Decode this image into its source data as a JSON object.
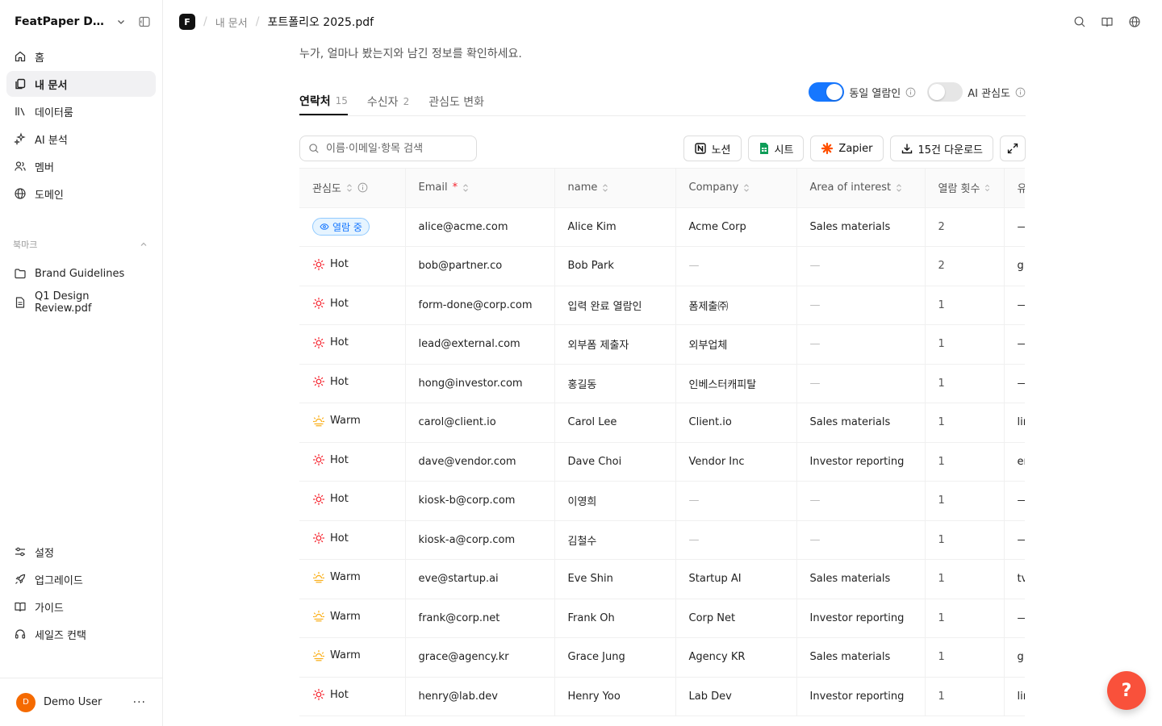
{
  "sidebar": {
    "workspace": "FeatPaper Desi...",
    "nav": [
      {
        "label": "홈",
        "icon": "home-icon"
      },
      {
        "label": "내 문서",
        "icon": "documents-icon",
        "active": true
      },
      {
        "label": "데이터룸",
        "icon": "library-icon"
      },
      {
        "label": "AI 분석",
        "icon": "sparkles-icon"
      },
      {
        "label": "멤버",
        "icon": "users-icon"
      },
      {
        "label": "도메인",
        "icon": "globe-icon"
      }
    ],
    "bookmark_title": "북마크",
    "bookmarks": [
      {
        "label": "Brand Guidelines",
        "icon": "folder-icon"
      },
      {
        "label": "Q1 Design Review.pdf",
        "icon": "file-icon"
      }
    ],
    "bottom": [
      {
        "label": "설정",
        "icon": "settings-icon"
      },
      {
        "label": "업그레이드",
        "icon": "rocket-icon"
      },
      {
        "label": "가이드",
        "icon": "book-icon"
      },
      {
        "label": "세일즈 컨택",
        "icon": "headset-icon"
      }
    ],
    "user": {
      "initial": "D",
      "name": "Demo User",
      "more": "···"
    }
  },
  "topbar": {
    "logo": "F",
    "crumbs": [
      "내 문서",
      "포트폴리오 2025.pdf"
    ]
  },
  "subtitle": "누가, 얼마나 봤는지와 남긴 정보를 확인하세요.",
  "tabs": [
    {
      "label": "연락처",
      "count": "15"
    },
    {
      "label": "수신자",
      "count": "2"
    },
    {
      "label": "관심도 변화",
      "count": ""
    }
  ],
  "toggles": {
    "same_viewer": {
      "label": "동일 열람인",
      "on": true
    },
    "ai_interest": {
      "label": "AI 관심도",
      "on": false
    }
  },
  "search": {
    "placeholder": "이름·이메일·항목 검색"
  },
  "buttons": {
    "notion": "노션",
    "sheet": "시트",
    "zapier": "Zapier",
    "download": "15건 다운로드"
  },
  "columns": [
    "관심도",
    "Email",
    "name",
    "Company",
    "Area of interest",
    "열람 횟수",
    "유"
  ],
  "required_mark": "*",
  "rows": [
    {
      "level": "viewing",
      "level_label": "열람 중",
      "email": "alice@acme.com",
      "name": "Alice Kim",
      "company": "Acme Corp",
      "area": "Sales materials",
      "views": "2",
      "extra": "—"
    },
    {
      "level": "hot",
      "level_label": "Hot",
      "email": "bob@partner.co",
      "name": "Bob Park",
      "company": "—",
      "area": "—",
      "views": "2",
      "extra": "gi"
    },
    {
      "level": "hot",
      "level_label": "Hot",
      "email": "form-done@corp.com",
      "name": "입력 완료 열람인",
      "company": "폼제출㈜",
      "area": "—",
      "views": "1",
      "extra": "—"
    },
    {
      "level": "hot",
      "level_label": "Hot",
      "email": "lead@external.com",
      "name": "외부폼 제출자",
      "company": "외부업체",
      "area": "—",
      "views": "1",
      "extra": "—"
    },
    {
      "level": "hot",
      "level_label": "Hot",
      "email": "hong@investor.com",
      "name": "홍길동",
      "company": "인베스터캐피탈",
      "area": "—",
      "views": "1",
      "extra": "—"
    },
    {
      "level": "warm",
      "level_label": "Warm",
      "email": "carol@client.io",
      "name": "Carol Lee",
      "company": "Client.io",
      "area": "Sales materials",
      "views": "1",
      "extra": "lir"
    },
    {
      "level": "hot",
      "level_label": "Hot",
      "email": "dave@vendor.com",
      "name": "Dave Choi",
      "company": "Vendor Inc",
      "area": "Investor reporting",
      "views": "1",
      "extra": "er"
    },
    {
      "level": "hot",
      "level_label": "Hot",
      "email": "kiosk-b@corp.com",
      "name": "이영희",
      "company": "—",
      "area": "—",
      "views": "1",
      "extra": "—"
    },
    {
      "level": "hot",
      "level_label": "Hot",
      "email": "kiosk-a@corp.com",
      "name": "김철수",
      "company": "—",
      "area": "—",
      "views": "1",
      "extra": "—"
    },
    {
      "level": "warm",
      "level_label": "Warm",
      "email": "eve@startup.ai",
      "name": "Eve Shin",
      "company": "Startup AI",
      "area": "Sales materials",
      "views": "1",
      "extra": "tv"
    },
    {
      "level": "warm",
      "level_label": "Warm",
      "email": "frank@corp.net",
      "name": "Frank Oh",
      "company": "Corp Net",
      "area": "Investor reporting",
      "views": "1",
      "extra": "—"
    },
    {
      "level": "warm",
      "level_label": "Warm",
      "email": "grace@agency.kr",
      "name": "Grace Jung",
      "company": "Agency KR",
      "area": "Sales materials",
      "views": "1",
      "extra": "gi"
    },
    {
      "level": "hot",
      "level_label": "Hot",
      "email": "henry@lab.dev",
      "name": "Henry Yoo",
      "company": "Lab Dev",
      "area": "Investor reporting",
      "views": "1",
      "extra": "lir"
    }
  ],
  "fab": "?",
  "colors": {
    "accent": "#1677ff",
    "hot": "#f5222d",
    "warm": "#faad14",
    "fab": "#f9513b"
  }
}
